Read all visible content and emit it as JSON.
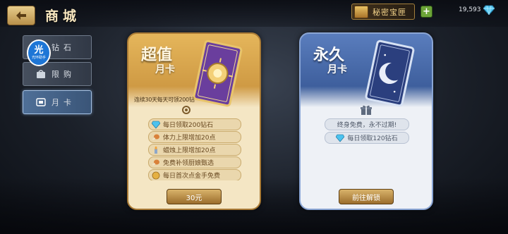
{
  "header": {
    "title": "商城",
    "treasure_label": "秘密宝匣",
    "gem_count": "19,593"
  },
  "nav": {
    "items": [
      {
        "label": "钻石",
        "icon": "diamond-icon",
        "active": false
      },
      {
        "label": "限购",
        "icon": "bag-icon",
        "active": false
      },
      {
        "label": "月卡",
        "icon": "card-icon",
        "active": true
      }
    ]
  },
  "logo": {
    "big": "光",
    "small": "光环助手"
  },
  "cards": {
    "premium": {
      "title": "超值",
      "subtitle": "月卡",
      "note": "连续30天每天可领200钻",
      "perks": [
        {
          "text": "每日领取200钻石",
          "icon": "diamond-icon"
        },
        {
          "text": "体力上限增加20点",
          "icon": "drumstick-icon"
        },
        {
          "text": "蜡烛上限增加20点",
          "icon": "candle-icon"
        },
        {
          "text": "免费补领厨娘甄选",
          "icon": "drumstick-icon"
        },
        {
          "text": "每日首次点金手免费",
          "icon": "coin-icon"
        }
      ],
      "button": "30元"
    },
    "forever": {
      "title": "永久",
      "subtitle": "月卡",
      "perks": [
        {
          "text": "终身免费，永不过期!"
        },
        {
          "text": "每日领取120钻石",
          "icon": "diamond-icon"
        }
      ],
      "button": "前往解锁"
    }
  },
  "colors": {
    "gold": "#d7a44f",
    "blue": "#4a6cab",
    "accent": "#f4d48a"
  }
}
